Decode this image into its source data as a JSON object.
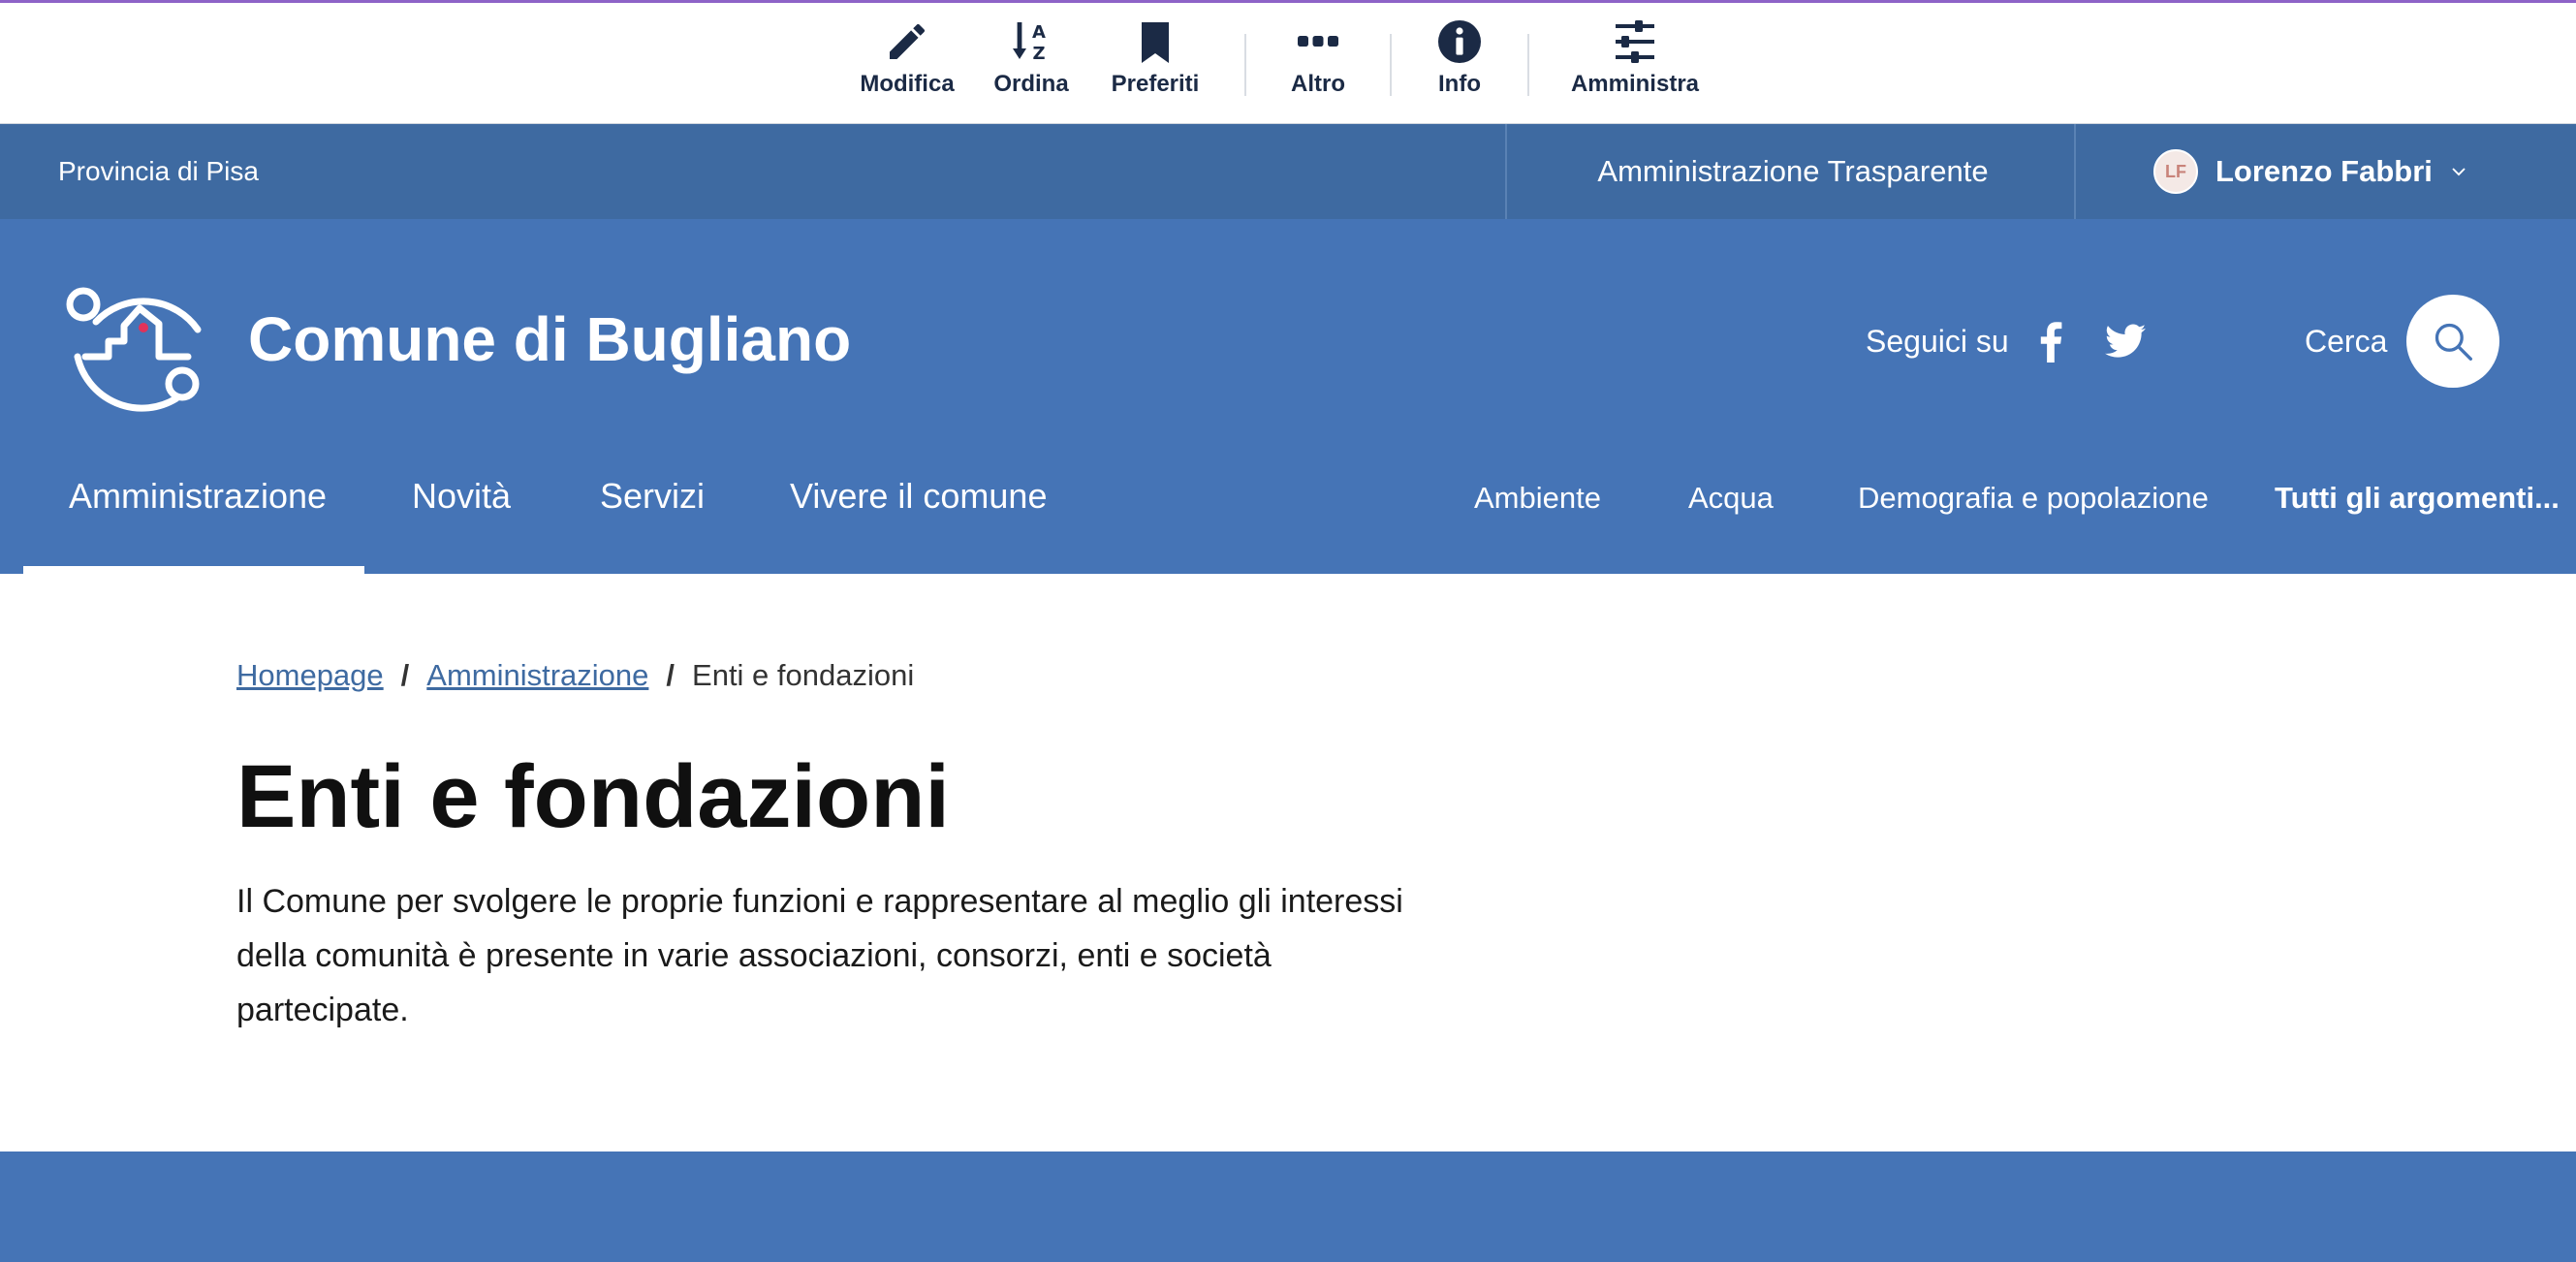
{
  "toolbar": {
    "items": [
      {
        "label": "Modifica",
        "icon": "pencil-icon"
      },
      {
        "label": "Ordina",
        "icon": "sort-az-icon"
      },
      {
        "label": "Preferiti",
        "icon": "bookmark-icon"
      },
      {
        "label": "Altro",
        "icon": "more-dots-icon"
      },
      {
        "label": "Info",
        "icon": "info-icon"
      },
      {
        "label": "Amministra",
        "icon": "sliders-icon"
      }
    ],
    "accent_color": "#8e63c7"
  },
  "slim_header": {
    "region": "Provincia di Pisa",
    "transparency_link": "Amministrazione Trasparente",
    "user": {
      "initials": "LF",
      "name": "Lorenzo Fabbri"
    }
  },
  "header": {
    "brand": "Comune di Bugliano",
    "follow_label": "Seguici su",
    "social": [
      "facebook-icon",
      "twitter-icon"
    ],
    "search_label": "Cerca",
    "colors": {
      "slim": "#3e6aa1",
      "main": "#4574b6"
    }
  },
  "nav": {
    "main": [
      "Amministrazione",
      "Novità",
      "Servizi",
      "Vivere il comune"
    ],
    "active": "Amministrazione",
    "topics": [
      "Ambiente",
      "Acqua",
      "Demografia e popolazione",
      "Tutti gli argomenti..."
    ]
  },
  "breadcrumb": {
    "items": [
      "Homepage",
      "Amministrazione"
    ],
    "current": "Enti e fondazioni",
    "separator": "/"
  },
  "page": {
    "title": "Enti e fondazioni",
    "lead": "Il Comune per svolgere le proprie funzioni e rappresentare al meglio gli interessi della comunità è presente in varie associazioni, consorzi, enti e società partecipate."
  }
}
